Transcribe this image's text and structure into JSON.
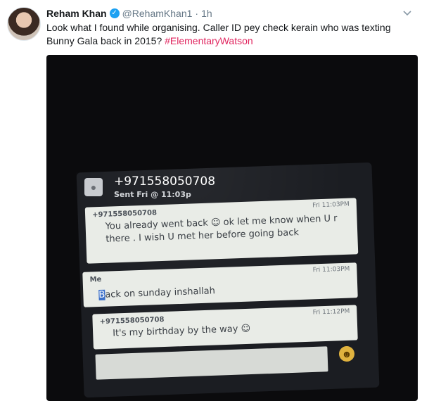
{
  "tweet": {
    "name": "Reham Khan",
    "handle": "@RehamKhan1",
    "separator": "·",
    "time": "1h",
    "text_before": "Look what I found while organising. Caller ID pey check kerain who was texting Bunny Gala back in 2015? ",
    "hashtag": "#ElementaryWatson",
    "verified_glyph": "✓",
    "menu_icon": "chevron-down-icon"
  },
  "photo": {
    "contact_number": "+971558050708",
    "sent_line": "Sent Fri @ 11:03p",
    "messages": [
      {
        "sender": "+971558050708",
        "time": "Fri 11:03PM",
        "body": "You already went back ☺ ok let me know when U r there . I wish U met her before going back"
      },
      {
        "sender": "Me",
        "time": "Fri 11:03PM",
        "body_first": "B",
        "body_rest": "ack on sunday inshallah"
      },
      {
        "sender": "+971558050708",
        "time": "Fri 11:12PM",
        "body": "It's my birthday by the way ☺"
      }
    ],
    "emoji_icon": "smiley-icon"
  }
}
